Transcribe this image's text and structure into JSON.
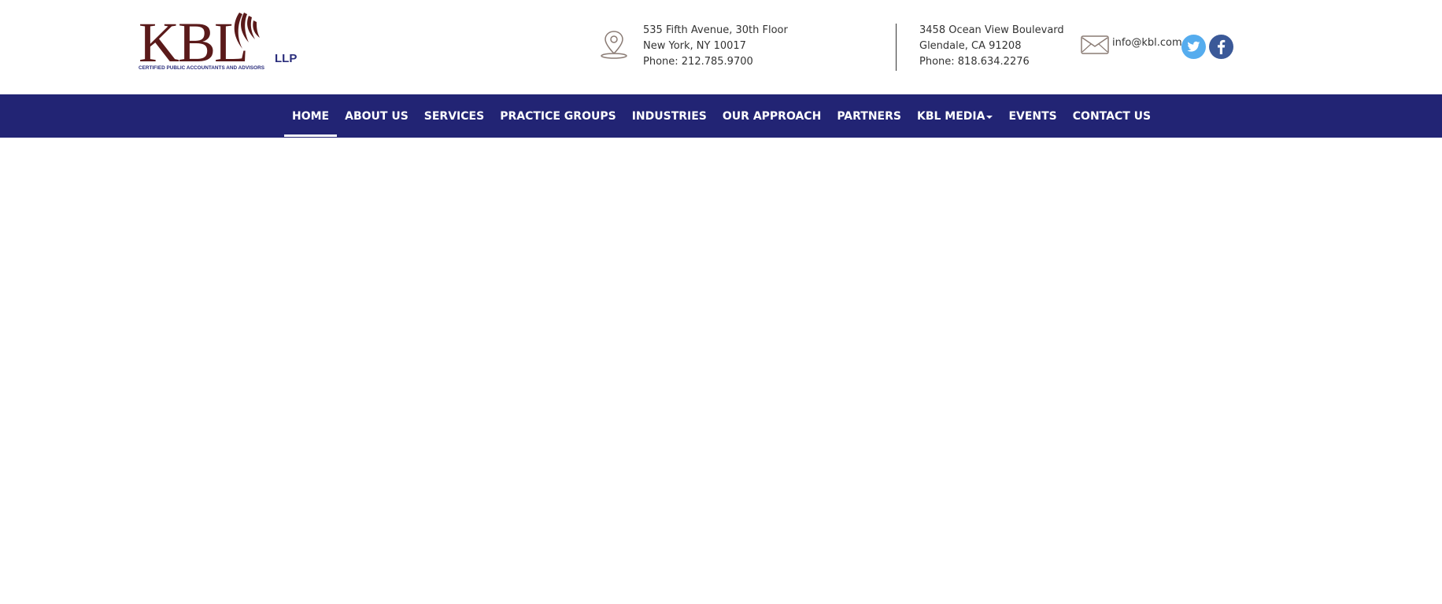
{
  "logo": {
    "brand": "KBL",
    "suffix": "LLP",
    "tagline": "CERTIFIED PUBLIC ACCOUNTANTS AND ADVISORS",
    "brand_color": "#5a1a1a",
    "accent_color": "#2a2d7c"
  },
  "offices": [
    {
      "icon": "map-pin-icon",
      "line1": "535 Fifth Avenue, 30th Floor",
      "line2": "New York, NY 10017",
      "phone": "Phone: 212.785.9700"
    },
    {
      "line1": "3458 Ocean View Boulevard",
      "line2": "Glendale, CA 91208",
      "phone": "Phone: 818.634.2276"
    }
  ],
  "contact": {
    "icon": "envelope-icon",
    "email": "info@kbl.com"
  },
  "social": [
    {
      "name": "twitter-icon",
      "color": "#55acee"
    },
    {
      "name": "facebook-icon",
      "color": "#3b5998"
    }
  ],
  "nav": {
    "background": "#222474",
    "items": [
      {
        "label": "HOME",
        "active": true
      },
      {
        "label": "ABOUT US"
      },
      {
        "label": "SERVICES"
      },
      {
        "label": "PRACTICE GROUPS"
      },
      {
        "label": "INDUSTRIES"
      },
      {
        "label": "OUR APPROACH"
      },
      {
        "label": "PARTNERS"
      },
      {
        "label": "KBL MEDIA",
        "dropdown": true
      },
      {
        "label": "EVENTS"
      },
      {
        "label": "CONTACT US"
      }
    ]
  }
}
